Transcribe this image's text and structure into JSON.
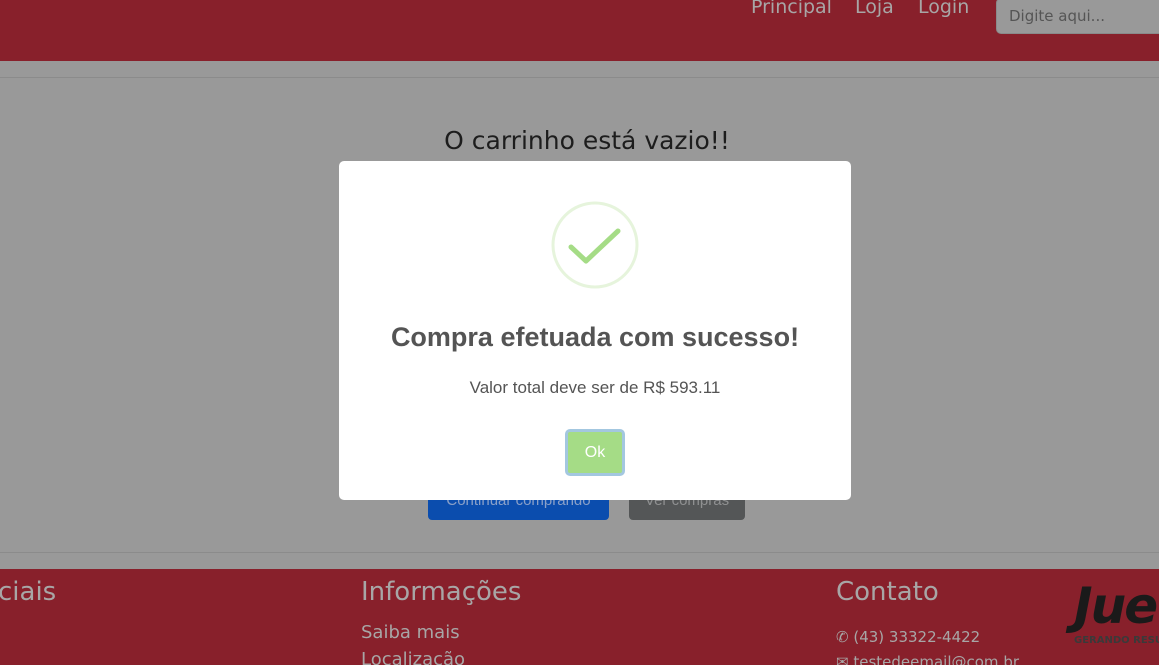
{
  "navbar": {
    "links": [
      "Principal",
      "Loja",
      "Login"
    ],
    "search_placeholder": "Digite aqui..."
  },
  "cart": {
    "empty_message": "O carrinho está vazio!!",
    "continue_label": "Continuar comprando",
    "purchases_label": "Ver compras"
  },
  "modal": {
    "icon": "success-check-icon",
    "title": "Compra efetuada com sucesso!",
    "text": "Valor total deve ser de R$ 593.11",
    "ok_label": "Ok",
    "ok_color": "#a5dc86"
  },
  "footer": {
    "social_heading": "ciais",
    "info_heading": "Informações",
    "info_links": [
      "Saiba mais",
      "Localização"
    ],
    "contact_heading": "Contato",
    "phone": "(43) 33322-4422",
    "email": "testedeemail@com.br",
    "logo_text": "Jue",
    "logo_tagline": "GERANDO RESU"
  },
  "colors": {
    "brand_red": "#88202b",
    "overlay": "#999999"
  }
}
